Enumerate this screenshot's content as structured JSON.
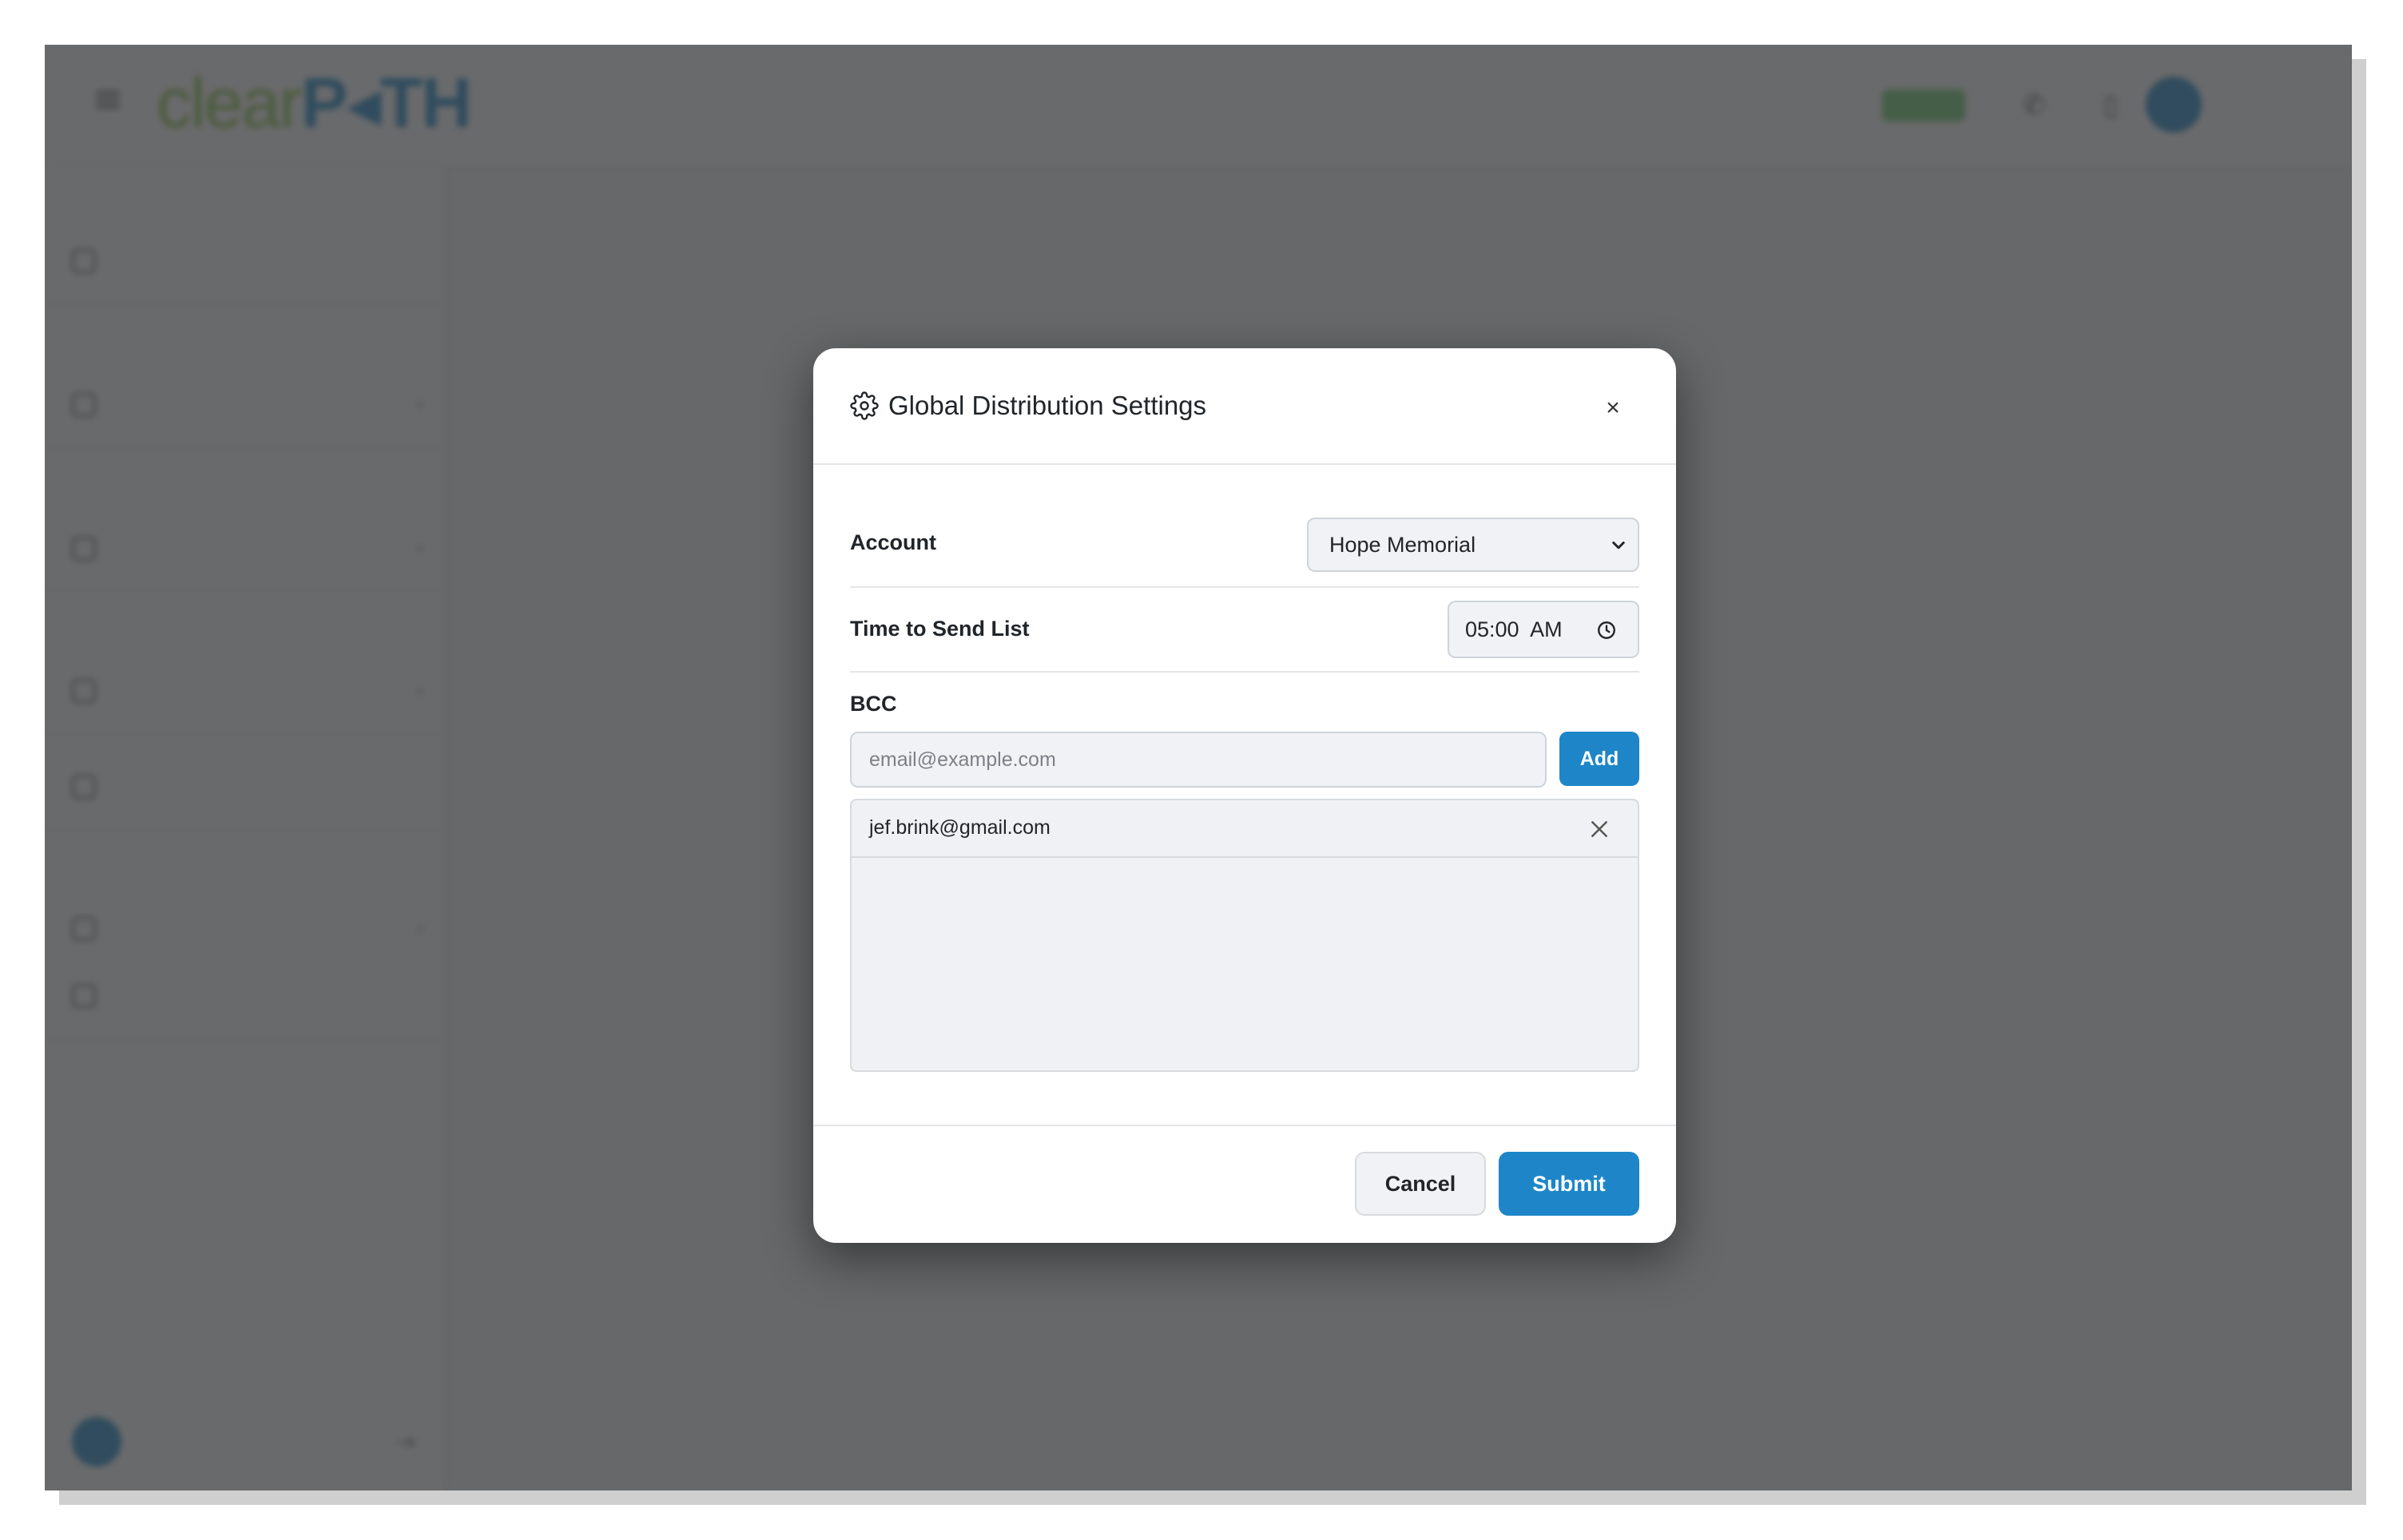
{
  "modal": {
    "title": "Global Distribution Settings",
    "title_icon": "gear-icon",
    "close_label": "×",
    "account": {
      "label": "Account",
      "selected": "Hope Memorial"
    },
    "time_to_send": {
      "label": "Time to Send List",
      "value": "05:00  AM"
    },
    "bcc": {
      "label": "BCC",
      "placeholder": "email@example.com",
      "add_label": "Add",
      "emails": [
        "jef.brink@gmail.com"
      ]
    },
    "footer": {
      "cancel_label": "Cancel",
      "submit_label": "Submit"
    }
  },
  "colors": {
    "primary": "#1e86c8",
    "overlay": "#37383a",
    "logo_green": "#8bc34a",
    "logo_blue": "#1e88c9"
  }
}
